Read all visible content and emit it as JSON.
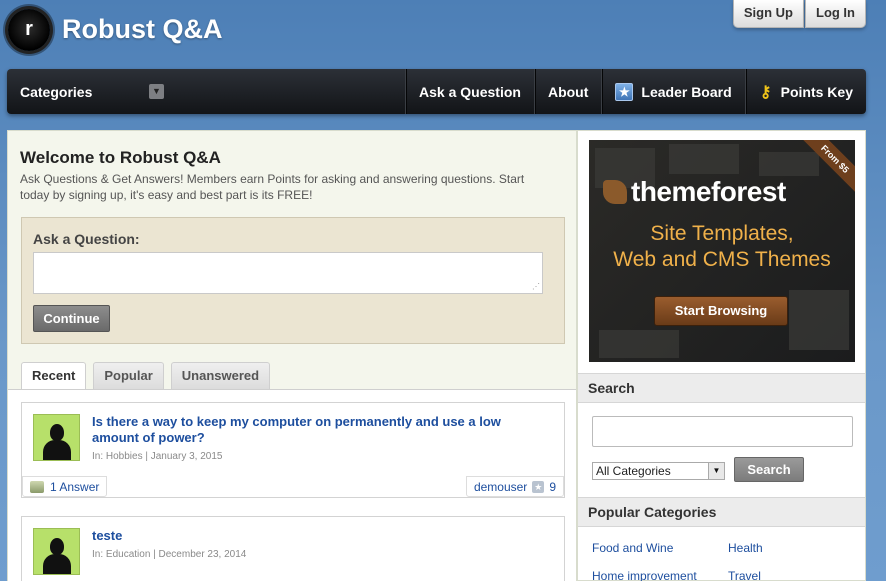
{
  "header": {
    "logo_letter": "r",
    "site_title": "Robust Q&A",
    "signup_label": "Sign Up",
    "login_label": "Log In"
  },
  "nav": {
    "categories_label": "Categories",
    "dropdown_glyph": "▼",
    "items": [
      {
        "label": "Ask a Question"
      },
      {
        "label": "About"
      },
      {
        "label": "Leader Board",
        "icon": "star-icon"
      },
      {
        "label": "Points Key",
        "icon": "key-icon"
      }
    ]
  },
  "welcome": {
    "title": "Welcome to Robust Q&A",
    "text": "Ask Questions & Get Answers! Members earn Points for asking and answering questions. Start today by signing up, it's easy and best part is its FREE!"
  },
  "ask": {
    "label": "Ask a Question:",
    "input_value": "",
    "continue_label": "Continue"
  },
  "tabs": [
    {
      "label": "Recent",
      "active": true
    },
    {
      "label": "Popular",
      "active": false
    },
    {
      "label": "Unanswered",
      "active": false
    }
  ],
  "questions": [
    {
      "title": "Is there a way to keep my computer on permanently and use a low amount of power?",
      "meta": "In: Hobbies | January 3, 2015",
      "answers": "1 Answer",
      "user": "demouser",
      "points": "9"
    },
    {
      "title": "teste",
      "meta": "In: Education | December 23, 2014"
    }
  ],
  "ad": {
    "ribbon": "From $5",
    "logo": "themeforest",
    "line1": "Site Templates,",
    "line2": "Web and CMS Themes",
    "button": "Start Browsing"
  },
  "sidebar": {
    "search_title": "Search",
    "search_value": "",
    "category_selected": "All Categories",
    "search_button": "Search",
    "popular_title": "Popular Categories",
    "popular": [
      "Food and Wine",
      "Health",
      "Home improvement",
      "Travel"
    ]
  },
  "colors": {
    "link": "#1d4e9e",
    "nav_bg": "#1a1d21",
    "page_bg": "#5b8cc1",
    "avatar_bg": "#b7e06a"
  }
}
